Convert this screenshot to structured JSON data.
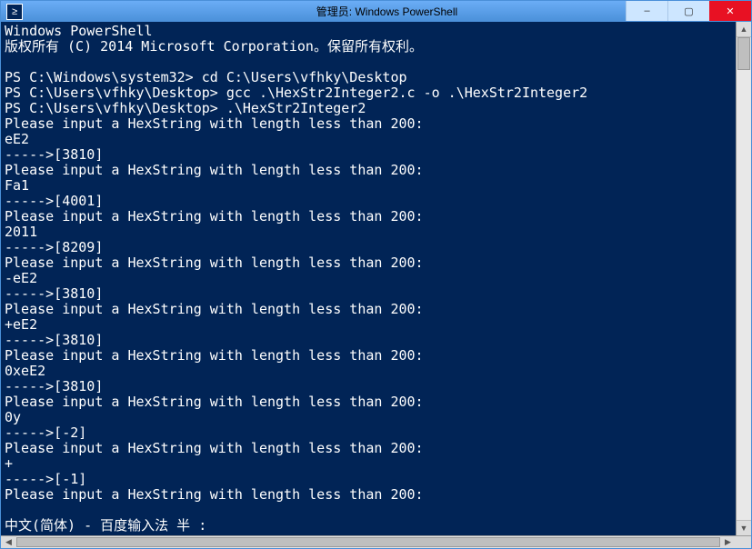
{
  "window": {
    "title": "管理员: Windows PowerShell",
    "icon_glyph": "≥"
  },
  "controls": {
    "minimize": "–",
    "maximize": "▢",
    "close": "✕"
  },
  "terminal_lines": [
    "Windows PowerShell",
    "版权所有 (C) 2014 Microsoft Corporation。保留所有权利。",
    "",
    "PS C:\\Windows\\system32> cd C:\\Users\\vfhky\\Desktop",
    "PS C:\\Users\\vfhky\\Desktop> gcc .\\HexStr2Integer2.c -o .\\HexStr2Integer2",
    "PS C:\\Users\\vfhky\\Desktop> .\\HexStr2Integer2",
    "Please input a HexString with length less than 200:",
    "eE2",
    "----->[3810]",
    "Please input a HexString with length less than 200:",
    "Fa1",
    "----->[4001]",
    "Please input a HexString with length less than 200:",
    "2011",
    "----->[8209]",
    "Please input a HexString with length less than 200:",
    "-eE2",
    "----->[3810]",
    "Please input a HexString with length less than 200:",
    "+eE2",
    "----->[3810]",
    "Please input a HexString with length less than 200:",
    "0xeE2",
    "----->[3810]",
    "Please input a HexString with length less than 200:",
    "0y",
    "----->[-2]",
    "Please input a HexString with length less than 200:",
    "+",
    "----->[-1]",
    "Please input a HexString with length less than 200:",
    "",
    "中文(简体) - 百度输入法 半 :"
  ]
}
